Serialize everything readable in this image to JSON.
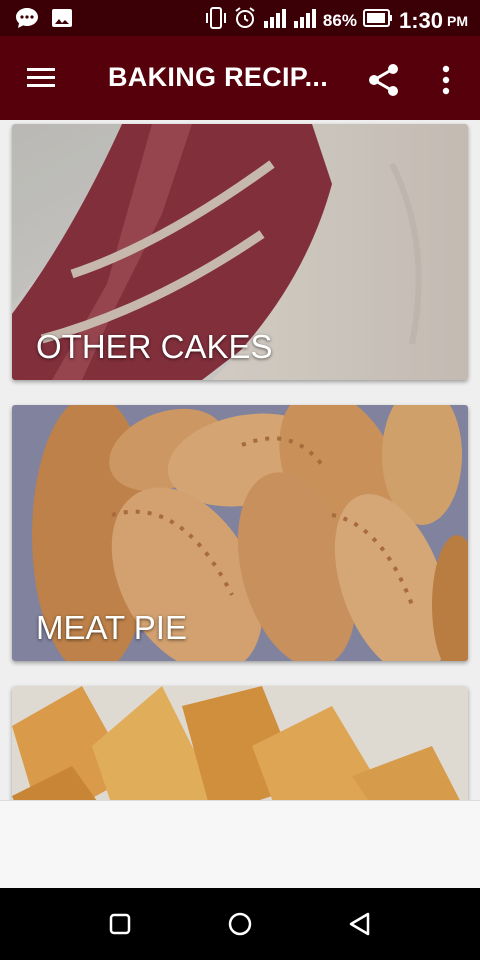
{
  "status_bar": {
    "icons_left": [
      "message-icon",
      "image-icon"
    ],
    "icons_right": [
      "vibrate-icon",
      "alarm-icon",
      "signal-icon",
      "signal-icon",
      "battery-icon"
    ],
    "battery": "86%",
    "time": "1:30",
    "ampm": "PM"
  },
  "app_bar": {
    "title": "BAKING RECIP...",
    "menu_icon": "hamburger-menu-icon",
    "share_icon": "share-icon",
    "more_icon": "more-vert-icon"
  },
  "cards": [
    {
      "caption": "OTHER CAKES"
    },
    {
      "caption": "MEAT PIE"
    },
    {
      "caption": ""
    }
  ],
  "nav_bar": {
    "recents_icon": "square-icon",
    "home_icon": "circle-icon",
    "back_icon": "triangle-back-icon"
  },
  "colors": {
    "status_bar": "#3a0006",
    "app_bar": "#55000b"
  }
}
